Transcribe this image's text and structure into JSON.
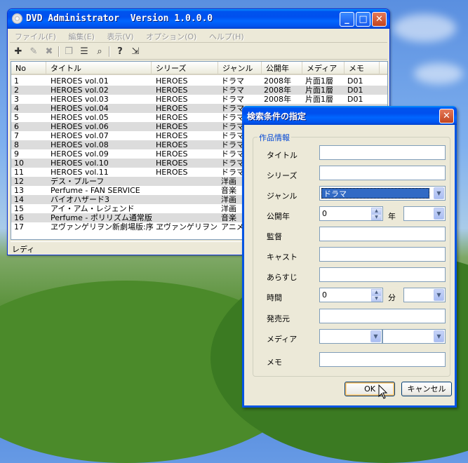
{
  "main_window": {
    "title": "DVD Administrator  Version 1.0.0.0",
    "menu": [
      "ファイル(F)",
      "編集(E)",
      "表示(V)",
      "オプション(O)",
      "ヘルプ(H)"
    ],
    "columns": [
      "No",
      "タイトル",
      "シリーズ",
      "ジャンル",
      "公開年",
      "メディア",
      "メモ"
    ],
    "rows": [
      [
        "1",
        "HEROES vol.01",
        "HEROES",
        "ドラマ",
        "2008年",
        "片面1層",
        "D01"
      ],
      [
        "2",
        "HEROES vol.02",
        "HEROES",
        "ドラマ",
        "2008年",
        "片面1層",
        "D01"
      ],
      [
        "3",
        "HEROES vol.03",
        "HEROES",
        "ドラマ",
        "2008年",
        "片面1層",
        "D01"
      ],
      [
        "4",
        "HEROES vol.04",
        "HEROES",
        "ドラマ",
        "",
        "",
        ""
      ],
      [
        "5",
        "HEROES vol.05",
        "HEROES",
        "ドラマ",
        "",
        "",
        ""
      ],
      [
        "6",
        "HEROES vol.06",
        "HEROES",
        "ドラマ",
        "",
        "",
        ""
      ],
      [
        "7",
        "HEROES vol.07",
        "HEROES",
        "ドラマ",
        "",
        "",
        ""
      ],
      [
        "8",
        "HEROES vol.08",
        "HEROES",
        "ドラマ",
        "",
        "",
        ""
      ],
      [
        "9",
        "HEROES vol.09",
        "HEROES",
        "ドラマ",
        "",
        "",
        ""
      ],
      [
        "10",
        "HEROES vol.10",
        "HEROES",
        "ドラマ",
        "",
        "",
        ""
      ],
      [
        "11",
        "HEROES vol.11",
        "HEROES",
        "ドラマ",
        "",
        "",
        ""
      ],
      [
        "12",
        "デス・プルーフ",
        "",
        "洋画",
        "",
        "",
        ""
      ],
      [
        "13",
        "Perfume - FAN SERVICE",
        "",
        "音楽",
        "",
        "",
        ""
      ],
      [
        "14",
        "バイオハザード3",
        "",
        "洋画",
        "",
        "",
        ""
      ],
      [
        "15",
        "アイ・アム・レジェンド",
        "",
        "洋画",
        "",
        "",
        ""
      ],
      [
        "16",
        "Perfume - ポリリズム通常版",
        "",
        "音楽",
        "",
        "",
        ""
      ],
      [
        "17",
        "ヱヴァンゲリヲン新劇場版:序",
        "ヱヴァンゲリヲン",
        "アニメ",
        "",
        "",
        ""
      ]
    ],
    "status": "レディ"
  },
  "dialog": {
    "title": "検索条件の指定",
    "group_label": "作品情報",
    "labels": {
      "title": "タイトル",
      "series": "シリーズ",
      "genre": "ジャンル",
      "year": "公開年",
      "year_unit": "年",
      "director": "監督",
      "cast": "キャスト",
      "synopsis": "あらすじ",
      "duration": "時間",
      "duration_unit": "分",
      "publisher": "発売元",
      "media": "メディア",
      "memo": "メモ"
    },
    "genre_value": "ドラマ",
    "year_value": "0",
    "duration_value": "0",
    "ok_label": "OK",
    "cancel_label": "キャンセル"
  },
  "colors": {
    "titlebar_blue": "#0053ee",
    "dialog_face": "#ece9d8",
    "selection": "#316ac5"
  }
}
